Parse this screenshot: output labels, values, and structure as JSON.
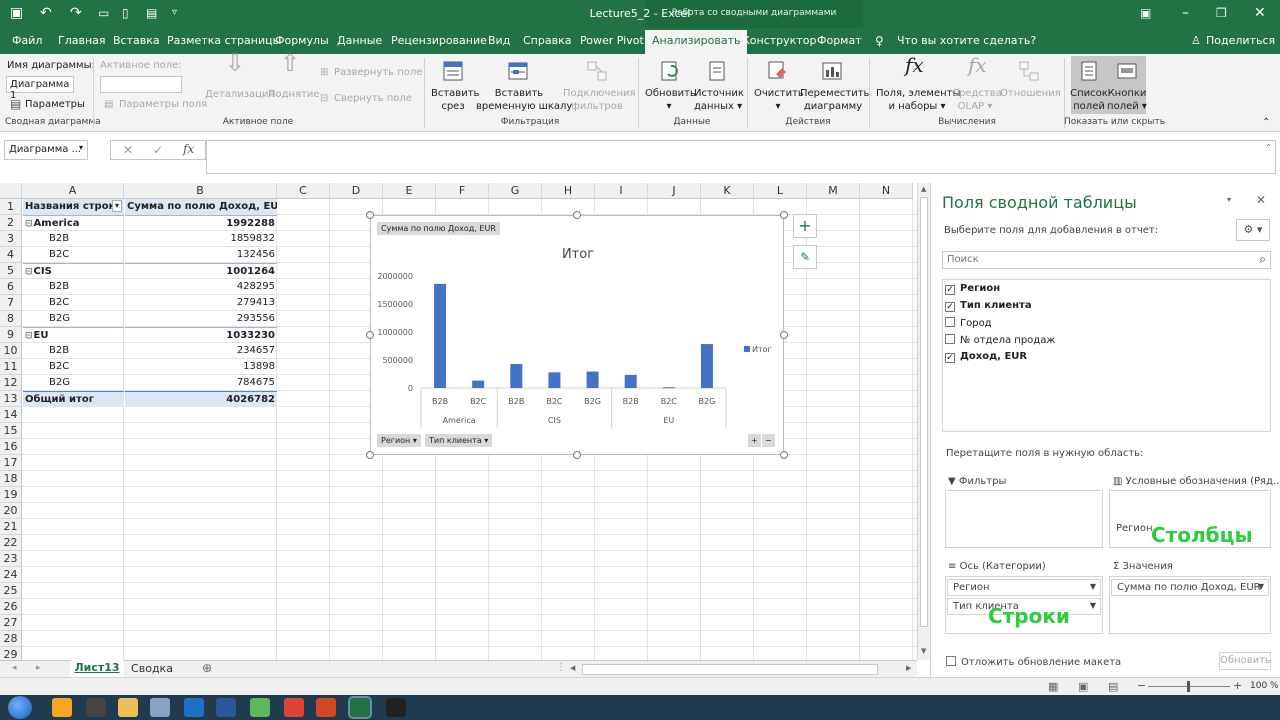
{
  "window": {
    "title": "Lecture5_2  -  Excel",
    "context_tool": "Работа со сводными диаграммами"
  },
  "tabs": [
    "Файл",
    "Главная",
    "Вставка",
    "Разметка страницы",
    "Формулы",
    "Данные",
    "Рецензирование",
    "Вид",
    "Справка",
    "Power Pivot",
    "Анализировать",
    "Конструктор",
    "Формат"
  ],
  "tell_me": "Что вы хотите сделать?",
  "share": "Поделиться",
  "ribbon": {
    "chart_name_label": "Имя диаграммы:",
    "chart_name_value": "Диаграмма 1",
    "params_label": "Параметры",
    "group_pivotchart": "Сводная диаграмма",
    "active_field_label": "Активное поле:",
    "field_params": "Параметры поля",
    "drilldown": "Детализация",
    "drillup": "Поднятие",
    "expand": "Развернуть поле",
    "collapse": "Свернуть поле",
    "group_active": "Активное поле",
    "insert_slicer_1": "Вставить",
    "insert_slicer_2": "срез",
    "insert_timeline_1": "Вставить",
    "insert_timeline_2": "временную шкалу",
    "filter_conn_1": "Подключения",
    "filter_conn_2": "фильтров",
    "group_filter": "Фильтрация",
    "refresh": "Обновить",
    "source_1": "Источник",
    "source_2": "данных",
    "group_data": "Данные",
    "clear": "Очистить",
    "move_1": "Переместить",
    "move_2": "диаграмму",
    "group_actions": "Действия",
    "fields_items_1": "Поля, элементы",
    "fields_items_2": "и наборы",
    "olap_1": "Средства",
    "olap_2": "OLAP",
    "relations": "Отношения",
    "group_calc": "Вычисления",
    "field_list_1": "Список",
    "field_list_2": "полей",
    "buttons_1": "Кнопки",
    "buttons_2": "полей",
    "group_show": "Показать или скрыть"
  },
  "namebox": "Диаграмма ...",
  "columns": [
    "A",
    "B",
    "C",
    "D",
    "E",
    "F",
    "G",
    "H",
    "I",
    "J",
    "K",
    "L",
    "M",
    "N"
  ],
  "rows": [
    "1",
    "2",
    "3",
    "4",
    "5",
    "6",
    "7",
    "8",
    "9",
    "10",
    "11",
    "12",
    "13",
    "14",
    "15",
    "16",
    "17",
    "18",
    "19",
    "20",
    "21",
    "22",
    "23",
    "24",
    "25",
    "26",
    "27",
    "28",
    "29"
  ],
  "pivot": {
    "header_a": "Названия строк",
    "header_b": "Сумма по полю Доход, EUR",
    "lines": [
      {
        "label": "America",
        "value": "1992288",
        "bold": true,
        "group": true
      },
      {
        "label": "B2B",
        "value": "1859832"
      },
      {
        "label": "B2C",
        "value": "132456"
      },
      {
        "label": "CIS",
        "value": "1001264",
        "bold": true,
        "group": true
      },
      {
        "label": "B2B",
        "value": "428295"
      },
      {
        "label": "B2C",
        "value": "279413"
      },
      {
        "label": "B2G",
        "value": "293556"
      },
      {
        "label": "EU",
        "value": "1033230",
        "bold": true,
        "group": true
      },
      {
        "label": "B2B",
        "value": "234657"
      },
      {
        "label": "B2C",
        "value": "13898"
      },
      {
        "label": "B2G",
        "value": "784675"
      }
    ],
    "total_label": "Общий итог",
    "total_value": "4026782"
  },
  "chart_data": {
    "type": "bar",
    "title": "Итог",
    "value_field_button": "Сумма  по полю Доход, EUR",
    "categories": [
      "B2B",
      "B2C",
      "B2B",
      "B2C",
      "B2G",
      "B2B",
      "B2C",
      "B2G"
    ],
    "groups": [
      {
        "name": "America",
        "count": 2
      },
      {
        "name": "CIS",
        "count": 3
      },
      {
        "name": "EU",
        "count": 3
      }
    ],
    "series": [
      {
        "name": "Итог",
        "values": [
          1859832,
          132456,
          428295,
          279413,
          293556,
          234657,
          13898,
          784675
        ]
      }
    ],
    "yticks": [
      "2000000",
      "1500000",
      "1000000",
      "500000",
      "0"
    ],
    "ylim": [
      0,
      2000000
    ],
    "legend": "right",
    "bar_color": "#4472c4",
    "axis_buttons": [
      "Регион",
      "Тип клиента"
    ]
  },
  "sheets": [
    "Лист13",
    "Сводка"
  ],
  "pane": {
    "title": "Поля сводной таблицы",
    "subtitle": "Выберите поля для добавления в отчет:",
    "search_placeholder": "Поиск",
    "fields": [
      {
        "label": "Регион",
        "checked": true
      },
      {
        "label": "Тип клиента",
        "checked": true
      },
      {
        "label": "Город",
        "checked": false
      },
      {
        "label": "№ отдела продаж",
        "checked": false
      },
      {
        "label": "Доход, EUR",
        "checked": true
      }
    ],
    "drag_hint": "Перетащите поля в нужную область:",
    "zone_filters": "Фильтры",
    "zone_legend": "Условные обозначения (Ряд...",
    "zone_axis": "Ось (Категории)",
    "zone_values": "Значения",
    "legend_item": "Регион",
    "axis_items": [
      "Регион",
      "Тип клиента"
    ],
    "values_item": "Сумма по полю Доход, EUR",
    "annotation_cols": "Столбцы",
    "annotation_rows": "Строки",
    "defer": "Отложить обновление макета",
    "update": "Обновить"
  },
  "status": {
    "zoom": "100 %"
  }
}
